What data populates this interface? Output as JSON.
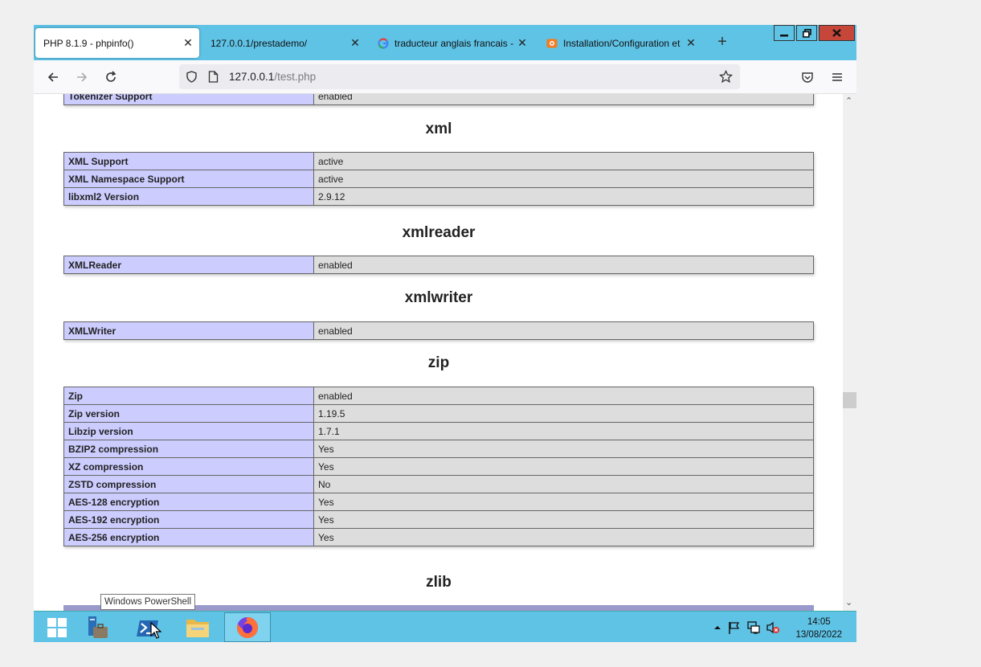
{
  "browser": {
    "tabs": [
      {
        "label": "PHP 8.1.9 - phpinfo()"
      },
      {
        "label": "127.0.0.1/prestademo/"
      },
      {
        "label": "traducteur anglais francais - G"
      },
      {
        "label": "Installation/Configuration et"
      }
    ],
    "new_tab_label": "+",
    "url_host": "127.0.0.1",
    "url_path": "/test.php"
  },
  "page": {
    "partial_row": {
      "key": "Tokenizer Support",
      "value": "enabled"
    },
    "sections": [
      {
        "title": "xml",
        "rows": [
          {
            "key": "XML Support",
            "value": "active"
          },
          {
            "key": "XML Namespace Support",
            "value": "active"
          },
          {
            "key": "libxml2 Version",
            "value": "2.9.12"
          }
        ]
      },
      {
        "title": "xmlreader",
        "rows": [
          {
            "key": "XMLReader",
            "value": "enabled"
          }
        ]
      },
      {
        "title": "xmlwriter",
        "rows": [
          {
            "key": "XMLWriter",
            "value": "enabled"
          }
        ]
      },
      {
        "title": "zip",
        "rows": [
          {
            "key": "Zip",
            "value": "enabled"
          },
          {
            "key": "Zip version",
            "value": "1.19.5"
          },
          {
            "key": "Libzip version",
            "value": "1.7.1"
          },
          {
            "key": "BZIP2 compression",
            "value": "Yes"
          },
          {
            "key": "XZ compression",
            "value": "Yes"
          },
          {
            "key": "ZSTD compression",
            "value": "No"
          },
          {
            "key": "AES-128 encryption",
            "value": "Yes"
          },
          {
            "key": "AES-192 encryption",
            "value": "Yes"
          },
          {
            "key": "AES-256 encryption",
            "value": "Yes"
          }
        ]
      },
      {
        "title": "zlib",
        "rows": []
      }
    ]
  },
  "taskbar": {
    "tooltip": "Windows PowerShell",
    "clock_time": "14:05",
    "clock_date": "13/08/2022"
  },
  "colors": {
    "chrome": "#5fc3e6",
    "key_cell": "#ccccff",
    "value_cell": "#dddddd"
  }
}
